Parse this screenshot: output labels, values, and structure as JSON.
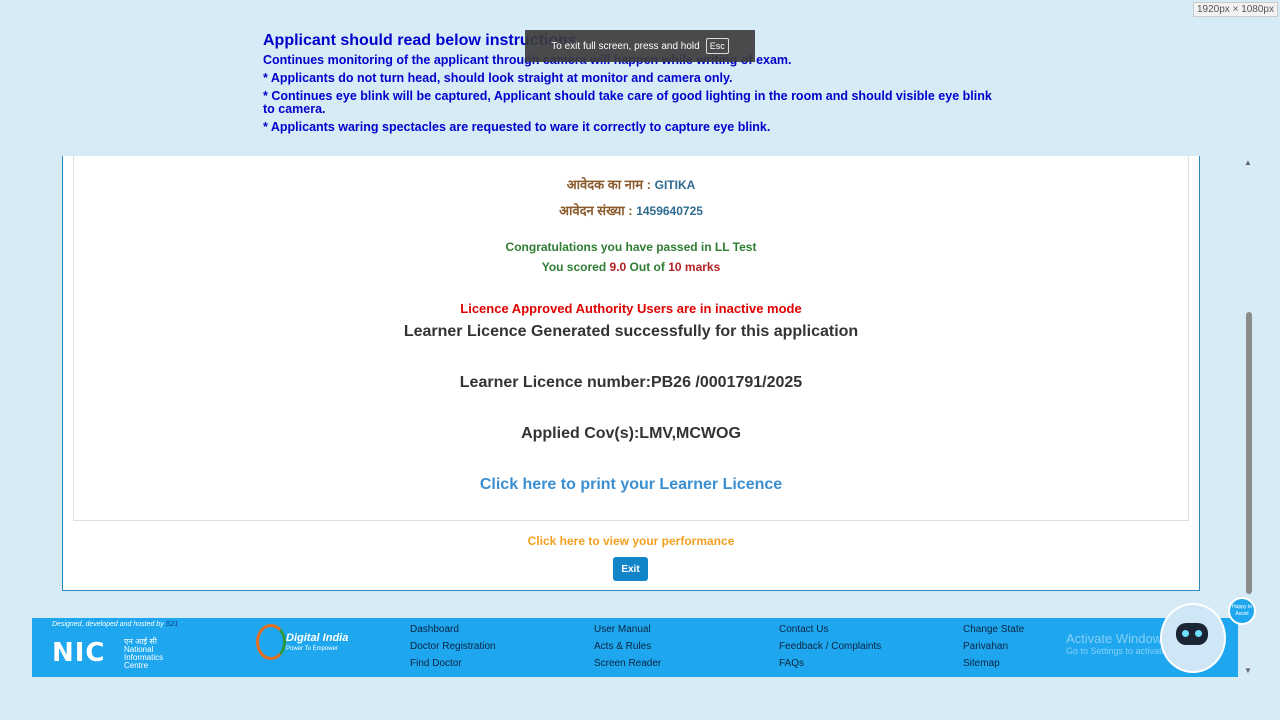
{
  "resolution_badge": "1920px × 1080px",
  "instructions": {
    "title": "Applicant should read below instructions",
    "lines": [
      "Continues monitoring of the applicant through camera will happen while writing of exam.",
      "* Applicants do not turn head, should look straight at monitor and camera only.",
      "* Continues eye blink will be captured, Applicant should take care of good lighting in the room and should visible eye blink to camera.",
      "* Applicants waring spectacles are requested to ware it correctly to capture eye blink."
    ]
  },
  "fullscreen_toast": {
    "text": "To exit full screen, press and hold",
    "key": "Esc"
  },
  "result": {
    "name_label": "आवेदक का नाम :",
    "name_value": "GITIKA",
    "app_label": "आवेदन संख्या :",
    "app_value": "1459640725",
    "congrats": "Congratulations you have passed in LL Test",
    "score_prefix": "You scored",
    "score": "9.0",
    "score_mid": "Out of",
    "total": "10",
    "score_suffix": "marks",
    "authority_msg": "Licence Approved Authority Users are in inactive mode",
    "generated_msg": "Learner Licence Generated successfully for this application",
    "ll_number": "Learner Licence number:PB26 /0001791/2025",
    "cov": "Applied Cov(s):LMV,MCWOG",
    "print_link": "Click here to print your Learner Licence"
  },
  "performance_link": "Click here to view your performance",
  "exit_label": "Exit",
  "footer": {
    "designed_by": "Designed, developed and hosted by",
    "nic_abbr": "NIC",
    "nic_hindi": "एन आई सी",
    "nic_en1": "National",
    "nic_en2": "Informatics",
    "nic_en3": "Centre",
    "digital_india": "Digital India",
    "digital_tag": "Power To Empower",
    "col1": [
      "Dashboard",
      "Doctor Registration",
      "Find Doctor"
    ],
    "col2": [
      "User Manual",
      "Acts & Rules",
      "Screen Reader"
    ],
    "col3": [
      "Contact Us",
      "Feedback / Complaints",
      "FAQs"
    ],
    "col4": [
      "Change State",
      "Parivahan",
      "Sitemap"
    ]
  },
  "watermark": {
    "line1": "Activate Windows",
    "line2": "Go to Settings to activate Windows."
  },
  "assistant_bubble": "Happy to Assist"
}
